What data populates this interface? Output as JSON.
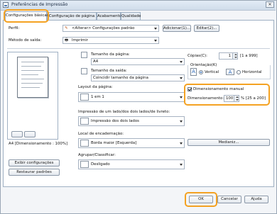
{
  "window": {
    "title": "Preferências de Impressão"
  },
  "tabs": [
    {
      "label": "Configurações básicas"
    },
    {
      "label": "Configuração de página"
    },
    {
      "label": "Acabamento"
    },
    {
      "label": "Qualidade"
    }
  ],
  "profile": {
    "label": "Perfil:",
    "value": "<Alterar> Configurações padrão",
    "add_button": "Adicionar(1)...",
    "edit_button": "Editar(2)..."
  },
  "output": {
    "label": "Método de saída:",
    "value": "Imprimir"
  },
  "paper": {
    "size_label": "Tamanho da página:",
    "size_value": "A4",
    "output_size_label": "Tamanho da saída:",
    "output_size_value": "Coincidir tamanho da página"
  },
  "copies": {
    "label": "Cópias(C):",
    "value": "1",
    "range": "[1 a 999]"
  },
  "orientation": {
    "label": "Orientação(K)",
    "vertical": "Vertical",
    "horizontal": "Horizontal"
  },
  "layout": {
    "label": "Layout da página:",
    "value": "1 em 1"
  },
  "scaling": {
    "manual_label": "Dimensionamento manual",
    "scale_label": "Dimensionamento:",
    "scale_value": "100",
    "scale_range": "% [25 a 200]"
  },
  "duplex": {
    "label": "Impressão de um lado/dos dois lados/de livreto:",
    "value": "Impressão dos dois lados"
  },
  "binding": {
    "label": "Local de encadernação:",
    "value": "Borda maior [Esquerda]",
    "margin_button": "Medianiz..."
  },
  "collate": {
    "label": "Agrupar/Classificar:",
    "value": "Desligado"
  },
  "preview": {
    "caption": "A4 [Dimensionamento : 100%]"
  },
  "left_buttons": {
    "show_settings": "Exibir configurações",
    "restore_defaults": "Restaurar padrões"
  },
  "footer": {
    "ok": "OK",
    "cancel": "Cancelar",
    "help": "Ajuda"
  }
}
